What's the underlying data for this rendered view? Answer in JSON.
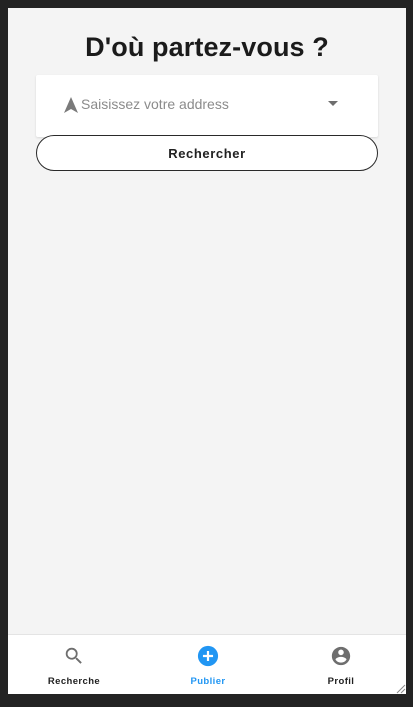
{
  "page": {
    "title": "D'où partez-vous ?"
  },
  "search": {
    "placeholder": "Saisissez votre address",
    "value": "",
    "leading_icon": "navigation-arrow-icon",
    "trailing_icon": "dropdown-caret-icon",
    "button_label": "Rechercher"
  },
  "bottom_nav": {
    "items": [
      {
        "label": "Recherche",
        "icon": "search-icon",
        "active": false,
        "color": "#1f1f1f"
      },
      {
        "label": "Publier",
        "icon": "add-circle-icon",
        "active": true,
        "color": "#2196f3"
      },
      {
        "label": "Profil",
        "icon": "account-circle-icon",
        "active": false,
        "color": "#1f1f1f"
      }
    ]
  },
  "colors": {
    "accent": "#2196f3",
    "background": "#f4f4f4",
    "text": "#1b1b1b",
    "icon_inactive": "#6e6e6e"
  }
}
